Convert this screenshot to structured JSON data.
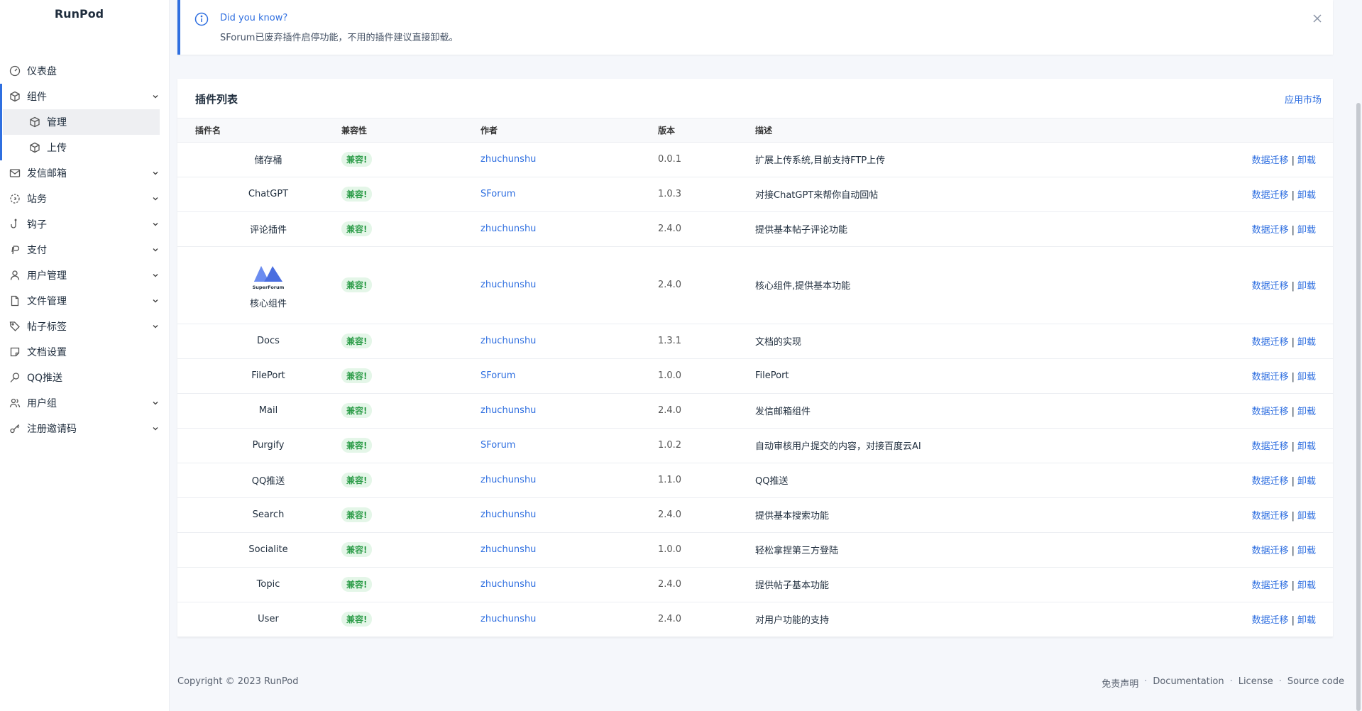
{
  "brand": "RunPod",
  "nav": {
    "dashboard": "仪表盘",
    "components": "组件",
    "components_manage": "管理",
    "components_upload": "上传",
    "mail": "发信邮箱",
    "site": "站务",
    "hooks": "钩子",
    "payment": "支付",
    "users": "用户管理",
    "files": "文件管理",
    "tags": "帖子标签",
    "docs": "文档设置",
    "qq": "QQ推送",
    "groups": "用户组",
    "invite": "注册邀请码"
  },
  "alert": {
    "title": "Did you know?",
    "message": "SForum已废弃插件启停功能，不用的插件建议直接卸载。"
  },
  "card": {
    "title": "插件列表",
    "market_link": "应用市场"
  },
  "table": {
    "headers": {
      "name": "插件名",
      "compat": "兼容性",
      "author": "作者",
      "version": "版本",
      "desc": "描述"
    },
    "action_migrate": "数据迁移",
    "action_separator": "|",
    "action_uninstall": "卸载",
    "logo_text": "SuperForum",
    "rows": [
      {
        "name": "储存桶",
        "compat": "兼容!",
        "author": "zhuchunshu",
        "version": "0.0.1",
        "desc": "扩展上传系统,目前支持FTP上传"
      },
      {
        "name": "ChatGPT",
        "compat": "兼容!",
        "author": "SForum",
        "version": "1.0.3",
        "desc": "对接ChatGPT来帮你自动回帖"
      },
      {
        "name": "评论插件",
        "compat": "兼容!",
        "author": "zhuchunshu",
        "version": "2.4.0",
        "desc": "提供基本帖子评论功能"
      },
      {
        "name": "核心组件",
        "compat": "兼容!",
        "author": "zhuchunshu",
        "version": "2.4.0",
        "desc": "核心组件,提供基本功能"
      },
      {
        "name": "Docs",
        "compat": "兼容!",
        "author": "zhuchunshu",
        "version": "1.3.1",
        "desc": "文档的实现"
      },
      {
        "name": "FilePort",
        "compat": "兼容!",
        "author": "SForum",
        "version": "1.0.0",
        "desc": "FilePort"
      },
      {
        "name": "Mail",
        "compat": "兼容!",
        "author": "zhuchunshu",
        "version": "2.4.0",
        "desc": "发信邮箱组件"
      },
      {
        "name": "Purgify",
        "compat": "兼容!",
        "author": "SForum",
        "version": "1.0.2",
        "desc": "自动审核用户提交的内容，对接百度云AI"
      },
      {
        "name": "QQ推送",
        "compat": "兼容!",
        "author": "zhuchunshu",
        "version": "1.1.0",
        "desc": "QQ推送"
      },
      {
        "name": "Search",
        "compat": "兼容!",
        "author": "zhuchunshu",
        "version": "2.4.0",
        "desc": "提供基本搜索功能"
      },
      {
        "name": "Socialite",
        "compat": "兼容!",
        "author": "zhuchunshu",
        "version": "1.0.0",
        "desc": "轻松拿捏第三方登陆"
      },
      {
        "name": "Topic",
        "compat": "兼容!",
        "author": "zhuchunshu",
        "version": "2.4.0",
        "desc": "提供帖子基本功能"
      },
      {
        "name": "User",
        "compat": "兼容!",
        "author": "zhuchunshu",
        "version": "2.4.0",
        "desc": "对用户功能的支持"
      }
    ]
  },
  "footer": {
    "copyright": "Copyright © 2023 RunPod",
    "disclaimer": "免责声明",
    "documentation": "Documentation",
    "license": "License",
    "source": "Source code",
    "dot": "·"
  },
  "colors": {
    "accent": "#2f6fe0",
    "badge_text": "#2e9d4a",
    "badge_bg": "#e4f6e8"
  }
}
